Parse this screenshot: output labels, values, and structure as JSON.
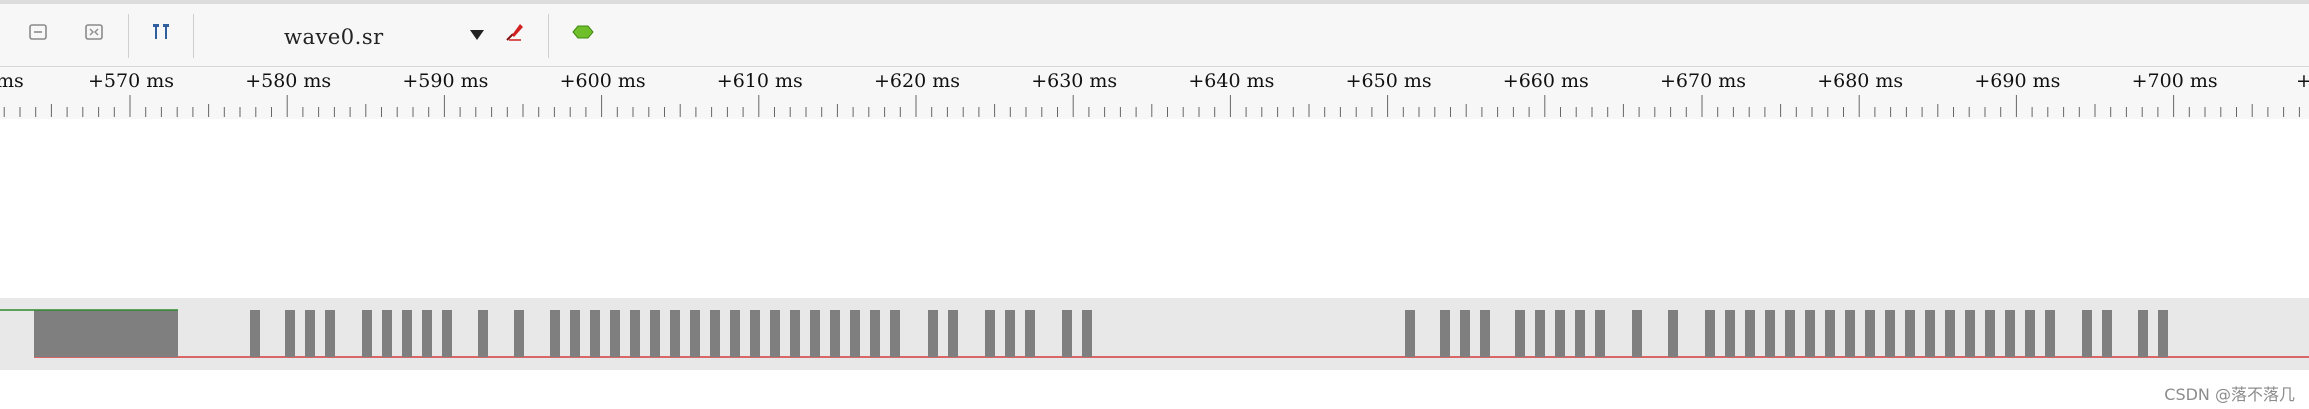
{
  "toolbar": {
    "file_name": "wave0.sr",
    "icons": [
      "minimize-icon",
      "fit-icon",
      "cursor-icon",
      "probe-icon",
      "decoder-icon"
    ]
  },
  "ruler": {
    "unit": "ms",
    "labels": [
      "ms",
      "+570 ms",
      "+580 ms",
      "+590 ms",
      "+600 ms",
      "+610 ms",
      "+620 ms",
      "+630 ms",
      "+640 ms",
      "+650 ms",
      "+660 ms",
      "+670 ms",
      "+680 ms",
      "+690 ms",
      "+700 ms",
      "+7"
    ]
  },
  "trace": {
    "high_color": "#7f7f7f",
    "low_color": "#d33b3b",
    "start_color": "#2e8b2e"
  },
  "colors": {
    "background": "#ffffff",
    "toolbar": "#f7f7f7",
    "trace_band": "#e8e8e8"
  },
  "watermark": "CSDN @落不落几"
}
